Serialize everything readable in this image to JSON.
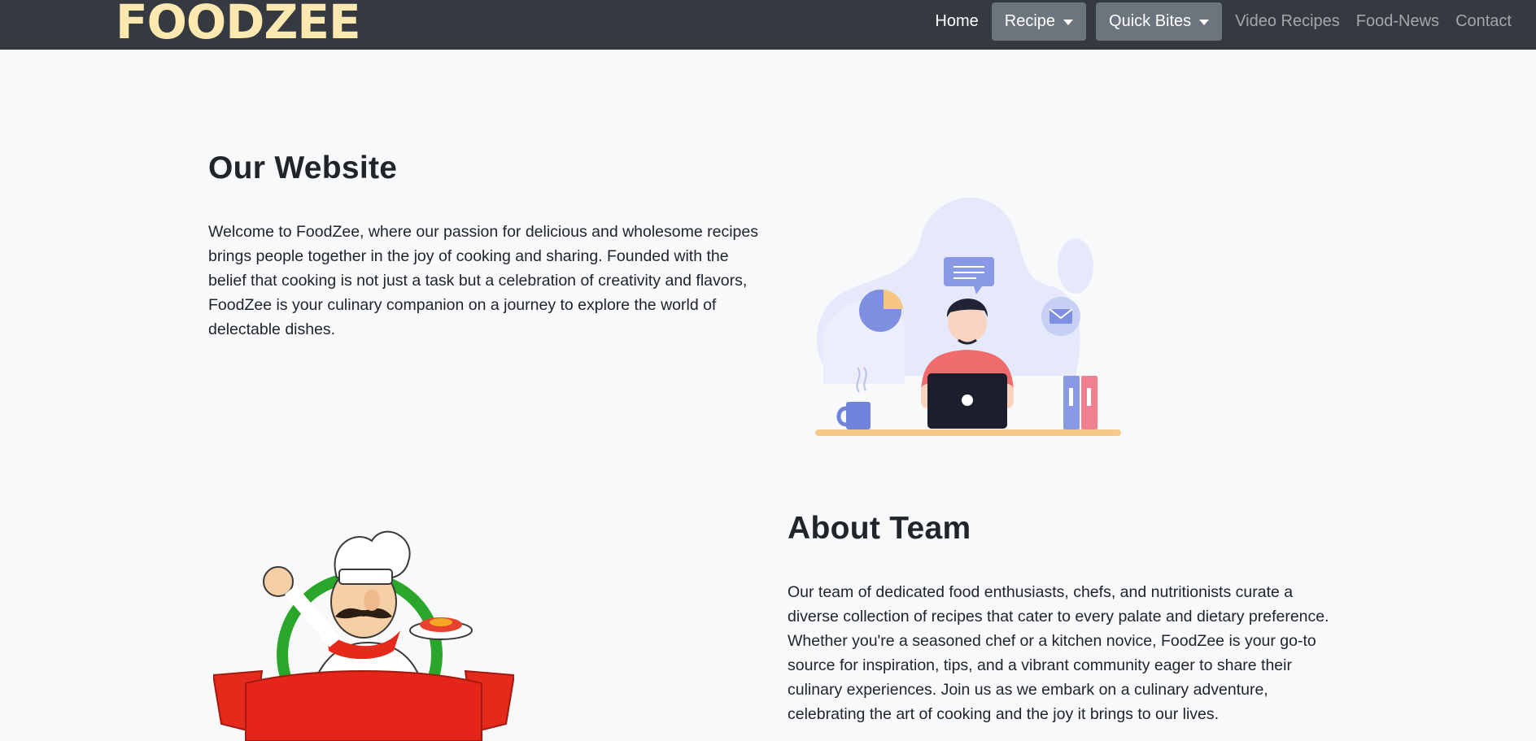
{
  "nav": {
    "logo": "FOODZEE",
    "home": "Home",
    "recipe": "Recipe",
    "quick_bites": "Quick Bites",
    "video_recipes": "Video Recipes",
    "food_news": "Food-News",
    "contact": "Contact"
  },
  "website": {
    "title": "Our Website",
    "text": "Welcome to FoodZee, where our passion for delicious and wholesome recipes brings people together in the joy of cooking and sharing. Founded with the belief that cooking is not just a task but a celebration of creativity and flavors, FoodZee is your culinary companion on a journey to explore the world of delectable dishes."
  },
  "team": {
    "title": "About Team",
    "text": "Our team of dedicated food enthusiasts, chefs, and nutritionists curate a diverse collection of recipes that cater to every palate and dietary preference. Whether you're a seasoned chef or a kitchen novice, FoodZee is your go-to source for inspiration, tips, and a vibrant community eager to share their culinary experiences. Join us as we embark on a culinary adventure, celebrating the art of cooking and the joy it brings to our lives."
  },
  "colors": {
    "navbar": "#343a40",
    "logo": "#fde8b0",
    "button": "#6c757d",
    "background": "#f8f9fa"
  }
}
